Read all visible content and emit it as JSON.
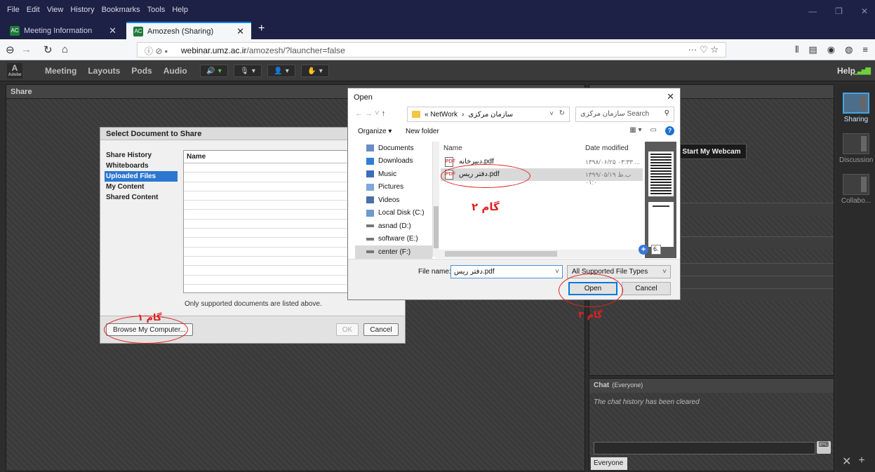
{
  "browser": {
    "menu": [
      "File",
      "Edit",
      "View",
      "History",
      "Bookmarks",
      "Tools",
      "Help"
    ],
    "tabs": [
      {
        "label": "Meeting Information",
        "favicon": "AC"
      },
      {
        "label": "Amozesh (Sharing)",
        "favicon": "AC"
      }
    ],
    "url_host": "webinar.umz.ac.ir",
    "url_path": "/amozesh/?launcher=false"
  },
  "app": {
    "logo_text": "Adobe",
    "menu": [
      "Meeting",
      "Layouts",
      "Pods",
      "Audio"
    ],
    "help": "Help",
    "share_pod_title": "Share",
    "webcam_button": "Start My Webcam",
    "chat": {
      "title": "Chat",
      "scope": "(Everyone)",
      "message": "The chat history has been cleared",
      "footer_tab": "Everyone"
    },
    "layouts": [
      {
        "label": "Sharing"
      },
      {
        "label": "Discussion"
      },
      {
        "label": "Collabo..."
      }
    ]
  },
  "select_doc": {
    "title": "Select Document to Share",
    "nav": [
      "Share History",
      "Whiteboards",
      "Uploaded Files",
      "My Content",
      "Shared Content"
    ],
    "selected_nav": "Uploaded Files",
    "column_name": "Name",
    "note": "Only supported documents are listed above.",
    "browse_button": "Browse My Computer...",
    "ok_button": "OK",
    "cancel_button": "Cancel"
  },
  "open_dialog": {
    "title": "Open",
    "path_parent": "« NetWork",
    "path_current": "سازمان مرکزی",
    "search_placeholder": "سازمان مرکزی Search",
    "organize": "Organize ▾",
    "new_folder": "New folder",
    "nav": [
      {
        "label": "Documents",
        "icon": "documents-icon",
        "color": "#6b8cc7"
      },
      {
        "label": "Downloads",
        "icon": "downloads-icon",
        "color": "#2f7fd6"
      },
      {
        "label": "Music",
        "icon": "music-icon",
        "color": "#3a6fbf"
      },
      {
        "label": "Pictures",
        "icon": "pictures-icon",
        "color": "#7fa7d8"
      },
      {
        "label": "Videos",
        "icon": "videos-icon",
        "color": "#4a6fa8"
      },
      {
        "label": "Local Disk (C:)",
        "icon": "disk-icon",
        "color": "#6b9bd1"
      },
      {
        "label": "asnad (D:)",
        "icon": "drive-icon",
        "color": "#777777"
      },
      {
        "label": "software (E:)",
        "icon": "drive-icon",
        "color": "#777777"
      },
      {
        "label": "center (F:)",
        "icon": "drive-icon",
        "color": "#777777"
      }
    ],
    "col_name": "Name",
    "col_date": "Date modified",
    "files": [
      {
        "name": "دبیرخانه.pdf",
        "date": "۱۳۹۸/۰۶/۲۵ ۰۳:۳۳ ..."
      },
      {
        "name": "دفتر ریس.pdf",
        "date": "۱۳۹۹/۰۵/۱۹ ب.ظ ۰۱:۰"
      }
    ],
    "selected_file": "دفتر ریس.pdf",
    "zoom_value": "6.",
    "file_name_label": "File name:",
    "file_name_value": "دفتر ریس.pdf",
    "filter": "All Supported File Types",
    "open_button": "Open",
    "cancel_button": "Cancel"
  },
  "annotations": {
    "step1": "گام ۱",
    "step2": "گام ۲",
    "step3": "گام ۳",
    "color": "#e02020"
  }
}
